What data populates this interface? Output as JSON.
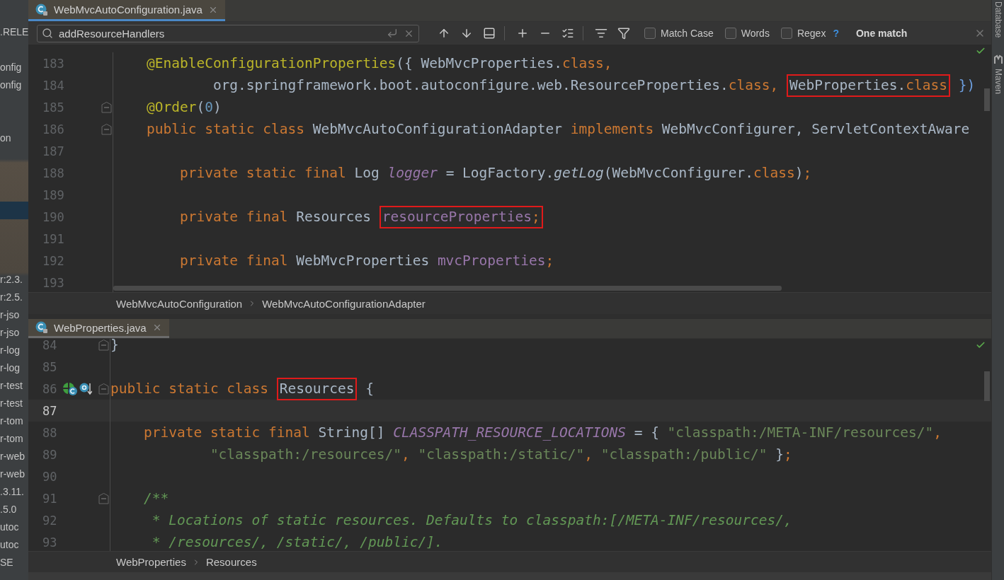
{
  "project_tree": {
    "items": [
      {
        "label": ".RELE"
      },
      {
        "label": "onfig"
      },
      {
        "label": "onfig"
      },
      {
        "label": "on"
      },
      {
        "label": "r:2.3."
      },
      {
        "label": "r:2.5."
      },
      {
        "label": "r-jso"
      },
      {
        "label": "r-jso"
      },
      {
        "label": "r-log"
      },
      {
        "label": "r-log"
      },
      {
        "label": "r-test"
      },
      {
        "label": "r-test"
      },
      {
        "label": "r-tom"
      },
      {
        "label": "r-tom"
      },
      {
        "label": "r-web"
      },
      {
        "label": "r-web"
      },
      {
        "label": ".3.11."
      },
      {
        "label": ".5.0"
      },
      {
        "label": "utoc"
      },
      {
        "label": "utoc"
      },
      {
        "label": "SE"
      }
    ]
  },
  "top_editor": {
    "tab": {
      "label": "WebMvcAutoConfiguration.java",
      "selected": true
    },
    "find_bar": {
      "query": "addResourceHandlers",
      "options": [
        {
          "label": "Match Case",
          "checked": false
        },
        {
          "label": "Words",
          "checked": false
        },
        {
          "label": "Regex",
          "checked": false
        }
      ],
      "help": "?",
      "result": "One match"
    },
    "lines": [
      {
        "number": "183",
        "fold": false,
        "tokens": [
          {
            "kind": "annotation",
            "text": "    @EnableConfigurationProperties"
          },
          {
            "kind": "plain",
            "text": "({ WebMvcProperties."
          },
          {
            "kind": "keyword",
            "text": "class,"
          }
        ]
      },
      {
        "number": "184",
        "fold": false,
        "tokens": [
          {
            "kind": "plain",
            "text": "            org.springframework.boot.autoconfigure.web.ResourceProperties."
          },
          {
            "kind": "keyword",
            "text": "class, "
          },
          {
            "kind": "boxed",
            "tokens": [
              {
                "kind": "plain",
                "text": "WebProperties."
              },
              {
                "kind": "keyword",
                "text": "class"
              }
            ]
          },
          {
            "kind": "brace",
            "text": " })"
          }
        ]
      },
      {
        "number": "185",
        "fold": true,
        "tokens": [
          {
            "kind": "annotation",
            "text": "    @Order"
          },
          {
            "kind": "plain",
            "text": "("
          },
          {
            "kind": "number",
            "text": "0"
          },
          {
            "kind": "plain",
            "text": ")"
          }
        ]
      },
      {
        "number": "186",
        "fold": true,
        "tokens": [
          {
            "kind": "keyword",
            "text": "    public static class "
          },
          {
            "kind": "plain",
            "text": "WebMvcAutoConfigurationAdapter "
          },
          {
            "kind": "keyword",
            "text": "implements "
          },
          {
            "kind": "plain",
            "text": "WebMvcConfigurer, ServletContextAware"
          }
        ]
      },
      {
        "number": "187",
        "fold": false
      },
      {
        "number": "188",
        "fold": false,
        "tokens": [
          {
            "kind": "keyword",
            "text": "        private static final "
          },
          {
            "kind": "plain",
            "text": "Log "
          },
          {
            "kind": "static",
            "text": "logger"
          },
          {
            "kind": "plain",
            "text": " = LogFactory."
          },
          {
            "kind": "call",
            "text": "getLog"
          },
          {
            "kind": "plain",
            "text": "(WebMvcConfigurer."
          },
          {
            "kind": "keyword",
            "text": "class"
          },
          {
            "kind": "plain",
            "text": ")"
          },
          {
            "kind": "keyword",
            "text": ";"
          }
        ]
      },
      {
        "number": "189",
        "fold": false
      },
      {
        "number": "190",
        "fold": false,
        "tokens": [
          {
            "kind": "keyword",
            "text": "        private final "
          },
          {
            "kind": "plain",
            "text": "Resources "
          },
          {
            "kind": "boxed",
            "tokens": [
              {
                "kind": "field",
                "text": "resourceProperties"
              },
              {
                "kind": "keyword",
                "text": ";"
              }
            ]
          }
        ]
      },
      {
        "number": "191",
        "fold": false
      },
      {
        "number": "192",
        "fold": false,
        "tokens": [
          {
            "kind": "keyword",
            "text": "        private final "
          },
          {
            "kind": "plain",
            "text": "WebMvcProperties "
          },
          {
            "kind": "field",
            "text": "mvcProperties"
          },
          {
            "kind": "keyword",
            "text": ";"
          }
        ]
      },
      {
        "number": "193",
        "fold": false
      }
    ],
    "breadcrumbs": [
      "WebMvcAutoConfiguration",
      "WebMvcAutoConfigurationAdapter"
    ]
  },
  "bottom_editor": {
    "tab": {
      "label": "WebProperties.java",
      "selected": true
    },
    "lines": [
      {
        "number": "84",
        "fold": true,
        "current": false,
        "marks": false,
        "tokens": [
          {
            "kind": "plain",
            "text": "}"
          }
        ]
      },
      {
        "number": "85",
        "fold": false,
        "current": false,
        "marks": false
      },
      {
        "number": "86",
        "fold": true,
        "current": false,
        "marks": true,
        "tokens": [
          {
            "kind": "keyword",
            "text": "public static class "
          },
          {
            "kind": "boxed",
            "tokens": [
              {
                "kind": "plain",
                "text": "Resources"
              }
            ]
          },
          {
            "kind": "plain",
            "text": " {"
          }
        ]
      },
      {
        "number": "87",
        "fold": false,
        "current": true,
        "marks": false
      },
      {
        "number": "88",
        "fold": false,
        "current": false,
        "marks": false,
        "tokens": [
          {
            "kind": "keyword",
            "text": "    private static final "
          },
          {
            "kind": "plain",
            "text": "String[] "
          },
          {
            "kind": "static",
            "text": "CLASSPATH_RESOURCE_LOCATIONS"
          },
          {
            "kind": "plain",
            "text": " = { "
          },
          {
            "kind": "string",
            "text": "\"classpath:/META-INF/resources/\""
          },
          {
            "kind": "keyword",
            "text": ","
          }
        ]
      },
      {
        "number": "89",
        "fold": false,
        "current": false,
        "marks": false,
        "tokens": [
          {
            "kind": "string",
            "text": "            \"classpath:/resources/\""
          },
          {
            "kind": "keyword",
            "text": ", "
          },
          {
            "kind": "string",
            "text": "\"classpath:/static/\""
          },
          {
            "kind": "keyword",
            "text": ", "
          },
          {
            "kind": "string",
            "text": "\"classpath:/public/\""
          },
          {
            "kind": "plain",
            "text": " }"
          },
          {
            "kind": "keyword",
            "text": ";"
          }
        ]
      },
      {
        "number": "90",
        "fold": false,
        "current": false,
        "marks": false
      },
      {
        "number": "91",
        "fold": true,
        "current": false,
        "marks": false,
        "tokens": [
          {
            "kind": "doc",
            "text": "    /**"
          }
        ]
      },
      {
        "number": "92",
        "fold": false,
        "current": false,
        "marks": false,
        "tokens": [
          {
            "kind": "doc",
            "text": "     * Locations of static resources. Defaults to classpath:[/META-INF/resources/,"
          }
        ]
      },
      {
        "number": "93",
        "fold": false,
        "current": false,
        "marks": false,
        "tokens": [
          {
            "kind": "doc",
            "text": "     * /resources/, /static/, /public/]."
          }
        ]
      }
    ],
    "breadcrumbs": [
      "WebProperties",
      "Resources"
    ]
  },
  "right_strip": [
    "Database",
    "Maven"
  ]
}
